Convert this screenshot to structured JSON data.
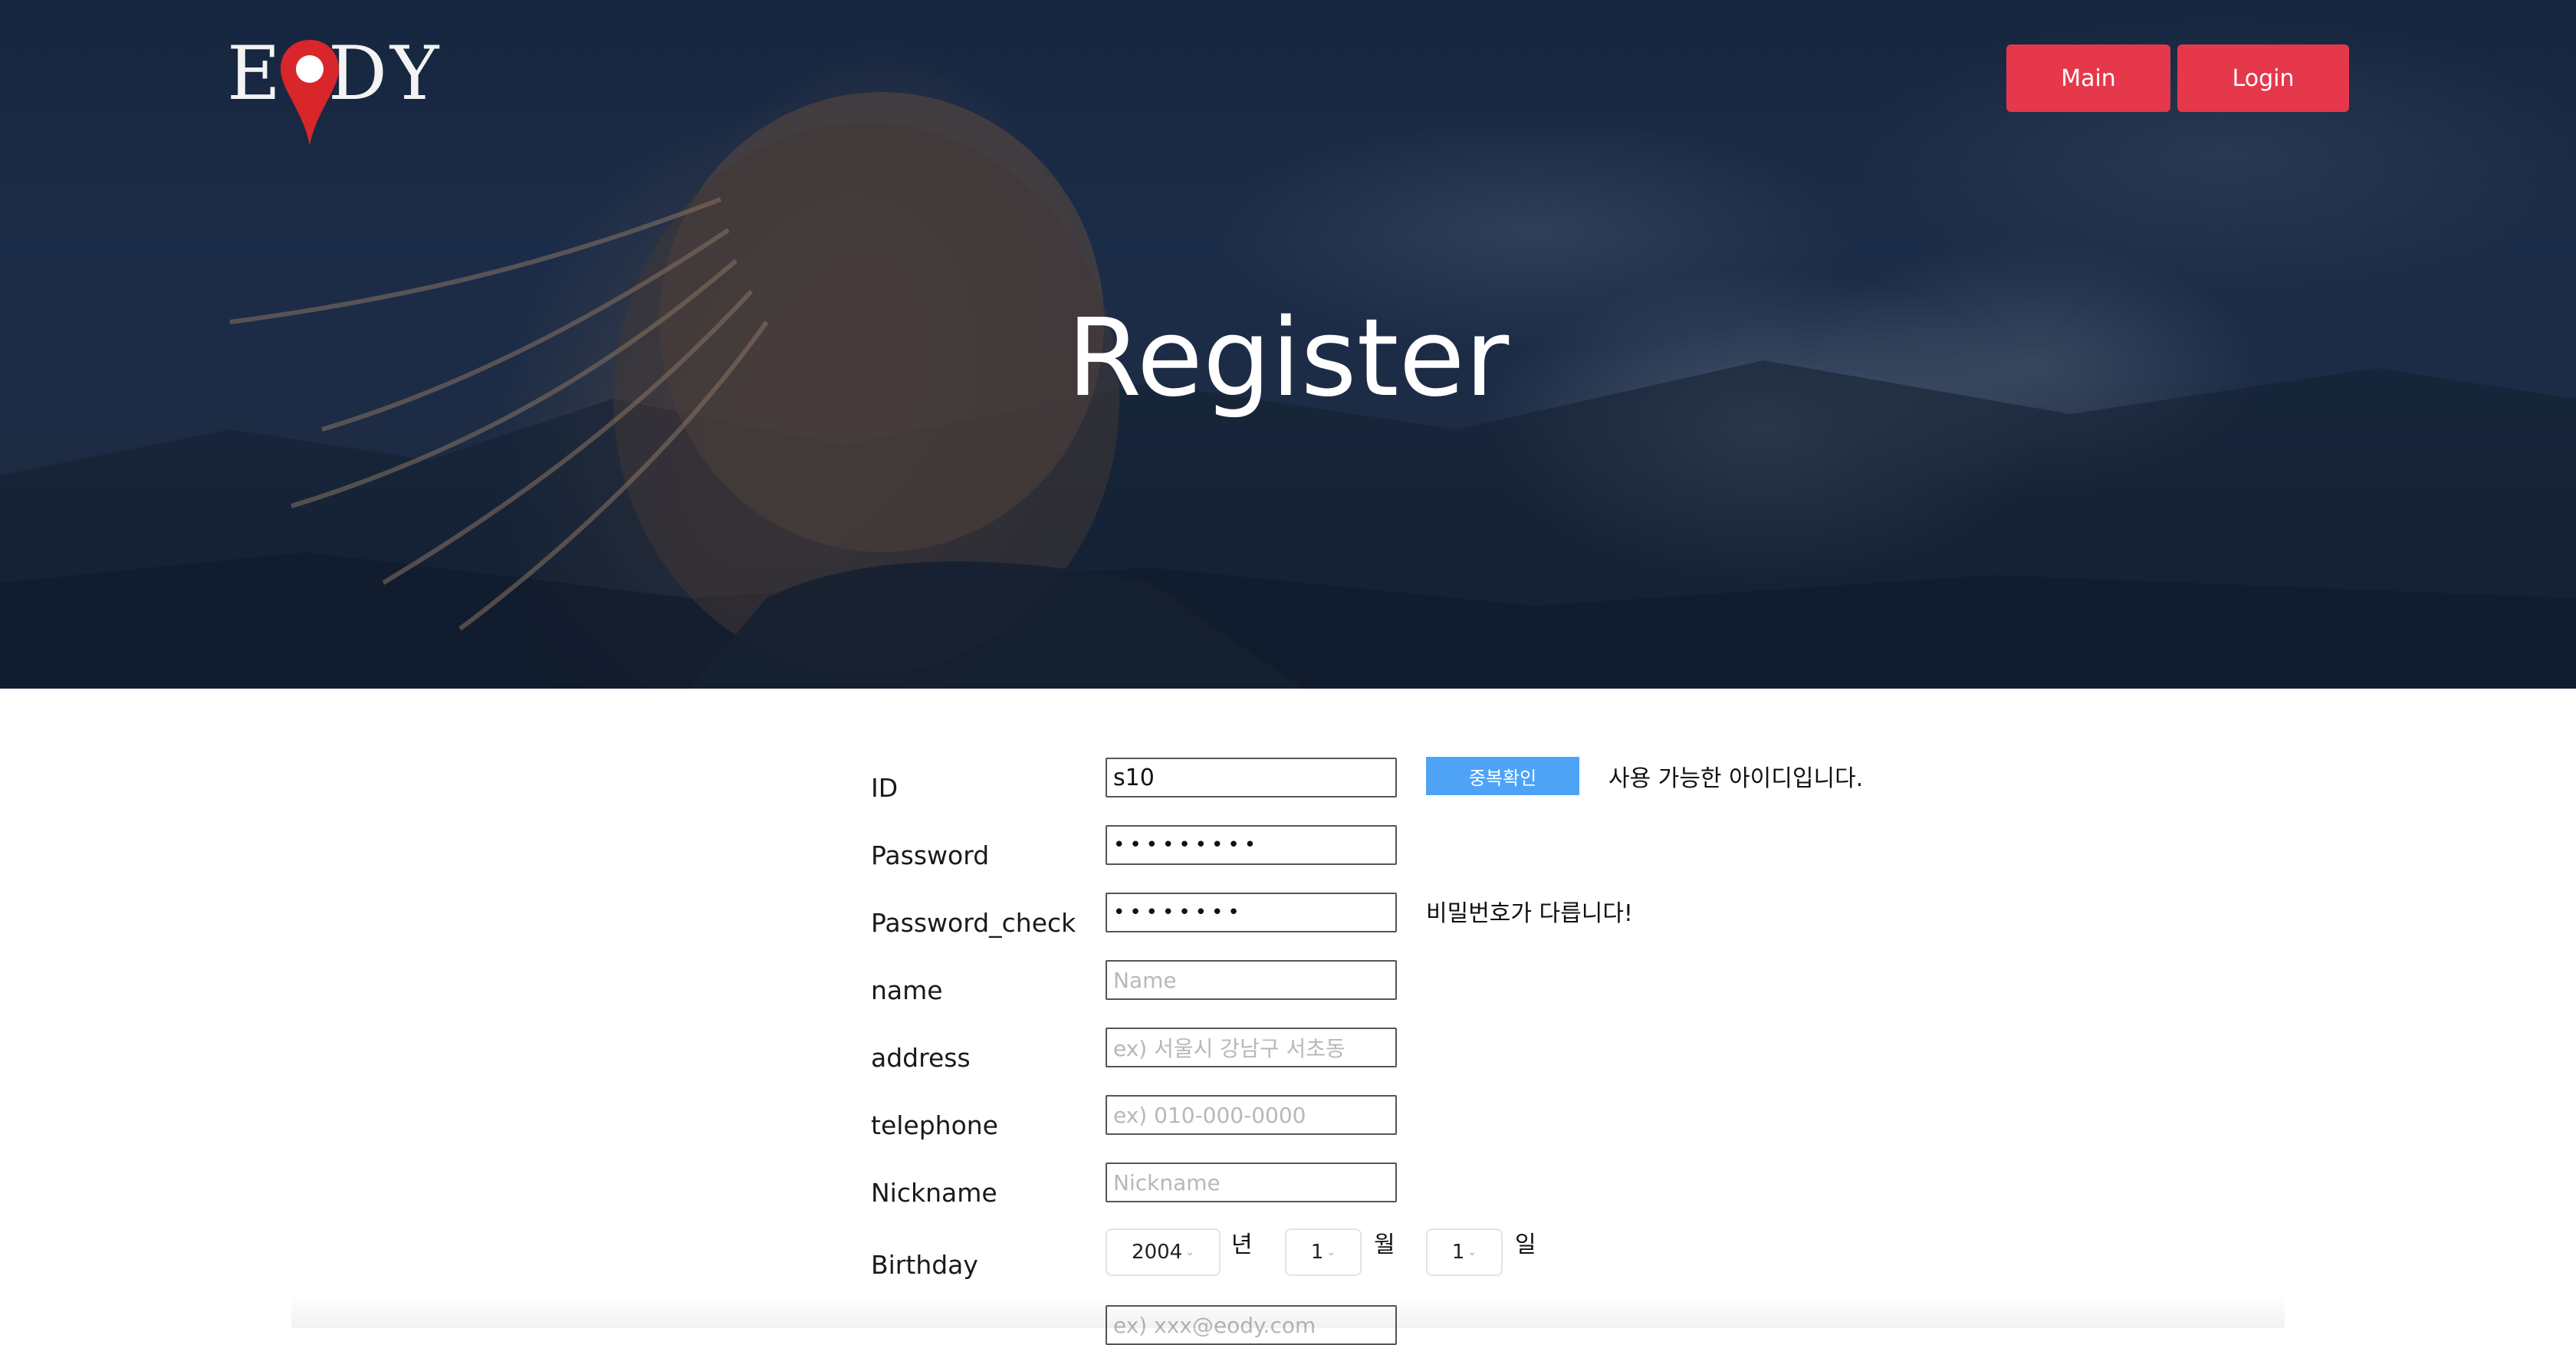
{
  "header": {
    "logo_left": "E",
    "logo_right": "DY",
    "nav": {
      "main_label": "Main",
      "login_label": "Login"
    },
    "title": "Register"
  },
  "form": {
    "id": {
      "label": "ID",
      "value": "s10",
      "check_button": "중복확인",
      "message": "사용 가능한 아이디입니다."
    },
    "password": {
      "label": "Password",
      "value": "•••••••••"
    },
    "password_check": {
      "label": "Password_check",
      "value": "••••••••",
      "message": "비밀번호가 다릅니다!"
    },
    "name": {
      "label": "name",
      "placeholder": "Name"
    },
    "address": {
      "label": "address",
      "placeholder": "ex) 서울시 강남구 서초동"
    },
    "telephone": {
      "label": "telephone",
      "placeholder": "ex) 010-000-0000"
    },
    "nickname": {
      "label": "Nickname",
      "placeholder": "Nickname"
    },
    "birthday": {
      "label": "Birthday",
      "year": "2004",
      "year_unit": "년",
      "month": "1",
      "month_unit": "월",
      "day": "1",
      "day_unit": "일"
    },
    "email": {
      "placeholder": "ex) xxx@eody.com"
    }
  },
  "colors": {
    "accent": "#e5384b",
    "check_button": "#4fa3f7",
    "hero_dark": "#1b2b45"
  },
  "icons": {
    "logo_pin": "map-pin-icon",
    "select_arrow": "chevron-down-icon"
  }
}
